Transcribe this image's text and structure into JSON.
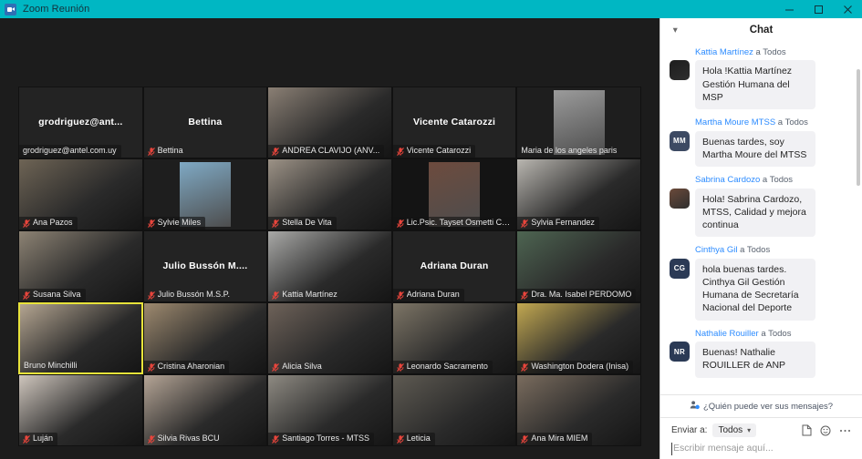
{
  "window": {
    "title": "Zoom Reunión",
    "app_icon": "zoom-video-icon",
    "controls": {
      "minimize": "minimize-icon",
      "maximize": "maximize-icon",
      "close": "close-icon"
    }
  },
  "video_grid": {
    "tiles": [
      {
        "id": "t1",
        "display_name": "grodriguez@ant...",
        "label": "grodriguez@antel.com.uy",
        "kind": "name-only",
        "muted": false,
        "speaking": false,
        "bg": "#232323",
        "label_bg": true
      },
      {
        "id": "t2",
        "display_name": "Bettina",
        "label": "Bettina",
        "kind": "name-only",
        "muted": true,
        "speaking": false,
        "bg": "#232323",
        "label_bg": false
      },
      {
        "id": "t3",
        "display_name": "",
        "label": "ANDREA CLAVIJO (ANV...",
        "kind": "video",
        "muted": true,
        "speaking": false,
        "bg": "#8a7f74",
        "label_bg": true
      },
      {
        "id": "t4",
        "display_name": "Vicente Catarozzi",
        "label": "Vicente Catarozzi",
        "kind": "name-only",
        "muted": true,
        "speaking": false,
        "bg": "#232323",
        "label_bg": true
      },
      {
        "id": "t5",
        "display_name": "",
        "label": "Maria de los angeles paris",
        "kind": "photo-inset",
        "muted": false,
        "speaking": false,
        "bg": "#1e1e1e",
        "inset": "#9b9b9b",
        "label_bg": false
      },
      {
        "id": "t6",
        "display_name": "",
        "label": "Ana Pazos",
        "kind": "video",
        "muted": true,
        "speaking": false,
        "bg": "#6e6455",
        "label_bg": true
      },
      {
        "id": "t7",
        "display_name": "",
        "label": "Sylvie Miles",
        "kind": "photo-inset",
        "muted": true,
        "speaking": false,
        "bg": "#1e1e1e",
        "inset": "#7fa9c4",
        "label_bg": true
      },
      {
        "id": "t8",
        "display_name": "",
        "label": "Stella De Vita",
        "kind": "video",
        "muted": true,
        "speaking": false,
        "bg": "#9c9286",
        "label_bg": true
      },
      {
        "id": "t9",
        "display_name": "",
        "label": "Lic.Psic. Tayset Osmetti Cor...",
        "kind": "photo-inset",
        "muted": true,
        "speaking": false,
        "bg": "#141414",
        "inset": "#6d4b3e",
        "label_bg": true
      },
      {
        "id": "t10",
        "display_name": "",
        "label": "Sylvia Fernandez",
        "kind": "video",
        "muted": true,
        "speaking": false,
        "bg": "#b9b6b0",
        "label_bg": true
      },
      {
        "id": "t11",
        "display_name": "",
        "label": "Susana Silva",
        "kind": "video",
        "muted": true,
        "speaking": false,
        "bg": "#8d8374",
        "label_bg": true
      },
      {
        "id": "t12",
        "display_name": "Julio Bussón M....",
        "label": "Julio Bussón M.S.P.",
        "kind": "name-only",
        "muted": true,
        "speaking": false,
        "bg": "#232323",
        "label_bg": false
      },
      {
        "id": "t13",
        "display_name": "",
        "label": "Kattia Martínez",
        "kind": "video",
        "muted": true,
        "speaking": false,
        "bg": "#a9a9a7",
        "label_bg": false
      },
      {
        "id": "t14",
        "display_name": "Adriana Duran",
        "label": "Adriana Duran",
        "kind": "name-only",
        "muted": true,
        "speaking": false,
        "bg": "#232323",
        "label_bg": true
      },
      {
        "id": "t15",
        "display_name": "",
        "label": "Dra. Ma. Isabel PERDOMO",
        "kind": "video",
        "muted": true,
        "speaking": false,
        "bg": "#4e6552",
        "label_bg": true
      },
      {
        "id": "t16",
        "display_name": "",
        "label": "Bruno Minchilli",
        "kind": "video",
        "muted": false,
        "speaking": true,
        "bg": "#b4a591",
        "label_bg": false
      },
      {
        "id": "t17",
        "display_name": "",
        "label": "Cristina Aharonian",
        "kind": "video",
        "muted": true,
        "speaking": false,
        "bg": "#9e8a6f",
        "label_bg": true
      },
      {
        "id": "t18",
        "display_name": "",
        "label": "Alicia Silva",
        "kind": "video",
        "muted": true,
        "speaking": false,
        "bg": "#6e6259",
        "label_bg": false
      },
      {
        "id": "t19",
        "display_name": "",
        "label": "Leonardo Sacramento",
        "kind": "video",
        "muted": true,
        "speaking": false,
        "bg": "#7d7566",
        "label_bg": true
      },
      {
        "id": "t20",
        "display_name": "",
        "label": "Washington Dodera (Inisa)",
        "kind": "video",
        "muted": true,
        "speaking": false,
        "bg": "#c2a851",
        "label_bg": true
      },
      {
        "id": "t21",
        "display_name": "",
        "label": "Luján",
        "kind": "video",
        "muted": true,
        "speaking": false,
        "bg": "#cfc6bd",
        "label_bg": true
      },
      {
        "id": "t22",
        "display_name": "",
        "label": "Silvia Rivas BCU",
        "kind": "video",
        "muted": true,
        "speaking": false,
        "bg": "#b5a596",
        "label_bg": false
      },
      {
        "id": "t23",
        "display_name": "",
        "label": "Santiago Torres - MTSS",
        "kind": "video",
        "muted": true,
        "speaking": false,
        "bg": "#8e8a82",
        "label_bg": true
      },
      {
        "id": "t24",
        "display_name": "",
        "label": "Leticia",
        "kind": "video",
        "muted": true,
        "speaking": false,
        "bg": "#5e5a52",
        "label_bg": true
      },
      {
        "id": "t25",
        "display_name": "",
        "label": "Ana Mira MIEM",
        "kind": "video",
        "muted": true,
        "speaking": false,
        "bg": "#7a6c5e",
        "label_bg": true
      }
    ]
  },
  "chat": {
    "header_title": "Chat",
    "collapse_icon": "chevron-down-icon",
    "messages": [
      {
        "from": "Kattia Martínez",
        "to": " a Todos",
        "avatar_initials": "",
        "avatar_color": "#1d1d1d",
        "avatar_kind": "photo",
        "text": "Hola !Kattia Martínez Gestión Humana del MSP"
      },
      {
        "from": "Martha Moure MTSS",
        "to": " a Todos",
        "avatar_initials": "MM",
        "avatar_color": "#3d4a63",
        "avatar_kind": "initials",
        "text": "Buenas tardes, soy Martha Moure del MTSS"
      },
      {
        "from": "Sabrina Cardozo",
        "to": " a Todos",
        "avatar_initials": "",
        "avatar_color": "#6b4a3a",
        "avatar_kind": "photo",
        "text": "Hola! Sabrina Cardozo, MTSS, Calidad y mejora continua"
      },
      {
        "from": "Cinthya Gil",
        "to": " a Todos",
        "avatar_initials": "CG",
        "avatar_color": "#2b3a55",
        "avatar_kind": "initials",
        "text": "hola buenas tardes. Cinthya Gil Gestión Humana de Secretaría Nacional del Deporte"
      },
      {
        "from": "Nathalie Rouiller",
        "to": " a Todos",
        "avatar_initials": "NR",
        "avatar_color": "#2b3a55",
        "avatar_kind": "initials",
        "text": "Buenas! Nathalie ROUILLER de ANP"
      }
    ],
    "privacy_note": "¿Quién puede ver sus mensajes?",
    "privacy_icon": "person-settings-icon",
    "footer": {
      "send_to_label": "Enviar a:",
      "send_to_value": "Todos",
      "send_to_options": [
        "Todos"
      ],
      "file_icon": "file-icon",
      "emoji_icon": "emoji-icon",
      "more_icon": "more-options-icon",
      "input_placeholder": "Escribir mensaje aquí..."
    }
  },
  "colors": {
    "titlebar": "#00b7c3",
    "accent_link": "#2d8cff",
    "speaking_border": "#e8e33a",
    "bubble_bg": "#f1f1f4"
  }
}
